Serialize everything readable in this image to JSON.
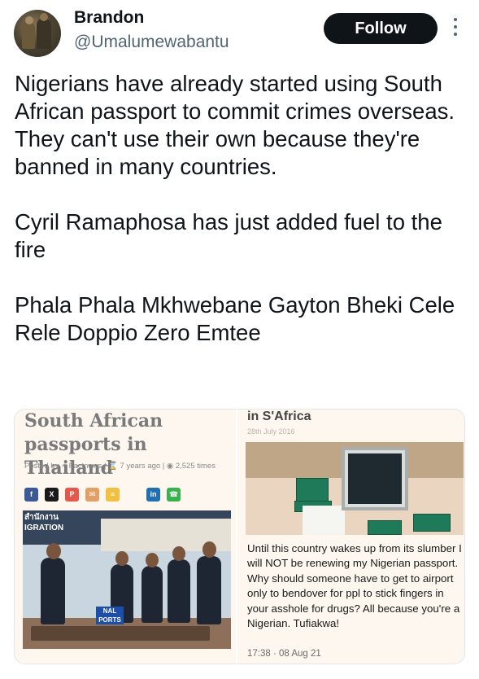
{
  "tweet": {
    "display_name": "Brandon",
    "handle": "@Umalumewabantu",
    "follow_label": "Follow",
    "paragraphs": [
      "Nigerians have already started using South African passport to commit crimes overseas. They can't use their own because they're banned in many countries.",
      "Cyril Ramaphosa has just added fuel to the fire",
      "Phala Phala Mkhwebane Gayton Bheki Cele Rele Doppio Zero Emtee"
    ]
  },
  "media": {
    "left": {
      "article_title": "South African passports in Thailand",
      "meta": "Posted by ♂ Factnews | ⌛ 7 years ago | ◉ 2,525 times",
      "share_buttons": [
        {
          "label": "f",
          "color": "#3b5998",
          "icon": "facebook-icon"
        },
        {
          "label": "X",
          "color": "#1a1a1a",
          "icon": "x-icon"
        },
        {
          "label": "P",
          "color": "#e4574b",
          "icon": "pinterest-icon"
        },
        {
          "label": "✉",
          "color": "#e3a066",
          "icon": "email-icon"
        },
        {
          "label": "≡",
          "color": "#f2c040",
          "icon": "print-icon"
        },
        {
          "label": "in",
          "color": "#1f6fb2",
          "icon": "linkedin-icon"
        },
        {
          "label": "☎",
          "color": "#37b24d",
          "icon": "whatsapp-icon"
        }
      ],
      "photo_banner_text": "สำนักงาน\nIGRATION",
      "photo_sign_text": "NAL\nPORTS"
    },
    "right": {
      "headline": "in S'Africa",
      "date": "28th July 2016",
      "comment": "Until this country wakes up from its slumber I will NOT be renewing my Nigerian passport. Why should someone have to get to airport only to bendover for ppl to stick fingers in your asshole for drugs? All because you're a Nigerian. Tufiakwa!",
      "time": "17:38 · 08 Aug 21"
    }
  }
}
